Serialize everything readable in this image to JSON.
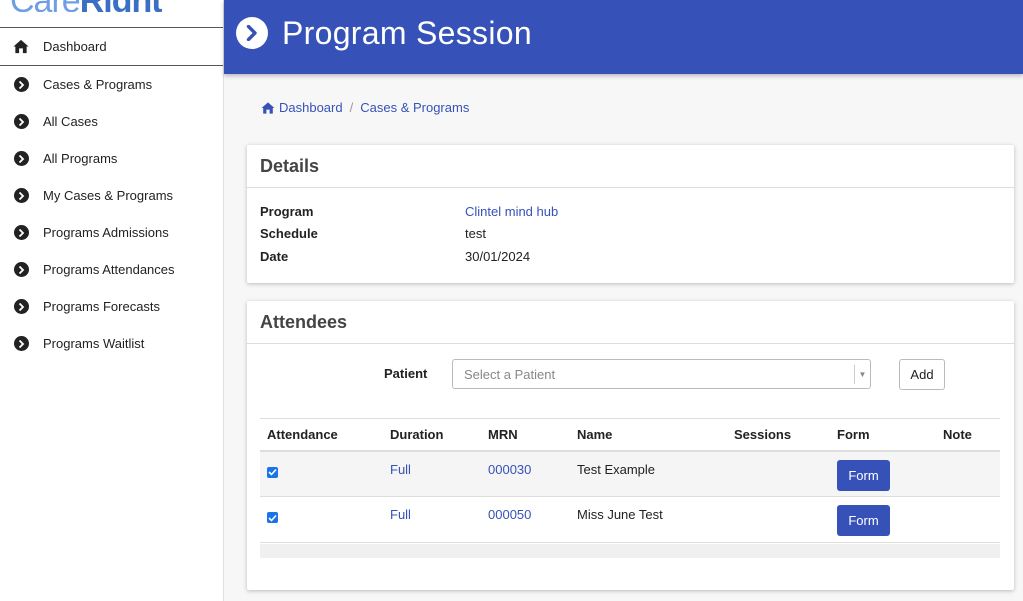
{
  "app": {
    "logo_light": "Care",
    "logo_bold": "Right"
  },
  "sidebar": {
    "items": [
      {
        "label": "Dashboard",
        "icon": "home-icon"
      },
      {
        "label": "Cases & Programs",
        "icon": "chevron-right-icon"
      },
      {
        "label": "All Cases",
        "icon": "chevron-right-icon"
      },
      {
        "label": "All Programs",
        "icon": "chevron-right-icon"
      },
      {
        "label": "My Cases & Programs",
        "icon": "chevron-right-icon"
      },
      {
        "label": "Programs Admissions",
        "icon": "chevron-right-icon"
      },
      {
        "label": "Programs Attendances",
        "icon": "chevron-right-icon"
      },
      {
        "label": "Programs Forecasts",
        "icon": "chevron-right-icon"
      },
      {
        "label": "Programs Waitlist",
        "icon": "chevron-right-icon"
      }
    ]
  },
  "header": {
    "title": "Program Session",
    "icon": "chevron-right-circle-icon"
  },
  "breadcrumb": {
    "items": [
      "Dashboard",
      "Cases & Programs"
    ]
  },
  "details": {
    "title": "Details",
    "rows": [
      {
        "label": "Program",
        "value": "Clintel mind hub"
      },
      {
        "label": "Schedule",
        "value": "test"
      },
      {
        "label": "Date",
        "value": "30/01/2024"
      }
    ]
  },
  "attendees": {
    "title": "Attendees",
    "patient_label": "Patient",
    "patient_placeholder": "Select a Patient",
    "add_label": "Add",
    "columns": [
      "Attendance",
      "Duration",
      "MRN",
      "Name",
      "Sessions",
      "Form",
      "Note"
    ],
    "rows": [
      {
        "attendance": true,
        "duration": "Full",
        "mrn": "000030",
        "name": "Test Example",
        "sessions": "",
        "form": "Form",
        "note": ""
      },
      {
        "attendance": true,
        "duration": "Full",
        "mrn": "000050",
        "name": "Miss June Test",
        "sessions": "",
        "form": "Form",
        "note": ""
      }
    ]
  },
  "colors": {
    "primary": "#3652b8",
    "checkbox": "#1a73e8"
  }
}
